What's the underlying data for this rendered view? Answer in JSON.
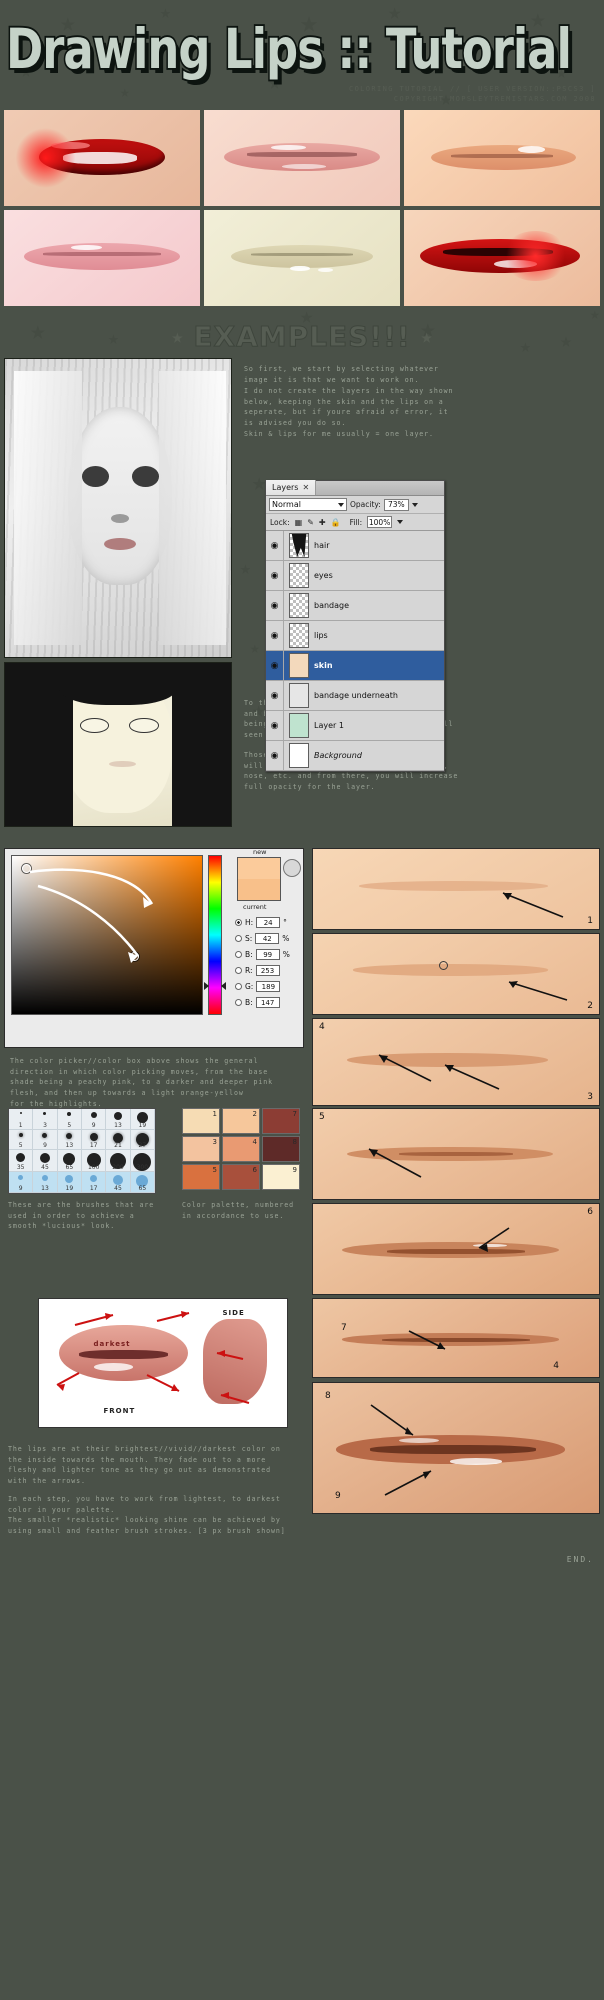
{
  "header": {
    "title": "Drawing Lips :: Tutorial",
    "subtitle_line1": "COLORING TUTORIAL // [ USER VERSION::PSCS3 ]",
    "subtitle_line2": "COPYRIGHT MOPSLEYTREMISTARS.COM 2008"
  },
  "banner": {
    "text": "EXAMPLES!!!",
    "star_left": "★",
    "star_right": "★"
  },
  "examples": {
    "row1": [
      {
        "name": "example-red-lips-open",
        "desc": "red glossy open lips with teeth"
      },
      {
        "name": "example-pink-gloss-lips",
        "desc": "soft pink glossy closed lips"
      },
      {
        "name": "example-peach-lips",
        "desc": "peach toned lips closeup"
      }
    ],
    "row2": [
      {
        "name": "example-pale-pink-lips",
        "desc": "pale pink lips with highlight"
      },
      {
        "name": "example-cream-lips",
        "desc": "cream colored lips"
      },
      {
        "name": "example-bright-red-lips",
        "desc": "bright red parted lips"
      }
    ]
  },
  "section1": {
    "paragraphs": [
      "So first, we start by selecting whatever\nimage it is that we want to work on.",
      "I do not create the layers in the way shown\nbelow, keeping the skin and the lips on a\nseperate, but if youre afraid of error, it\nis advised you do so.\nSkin & lips for me usually = one layer.",
      "To the left, the skin has been filled in,\nand because of the *layer 1* and *skin*\nbeing on a low opacity, the sketch is still\nseen underneath.",
      "Those are the guidelines. With those, you\nwill create the general shape of the lips,\nnose, etc. and from there, you will increase\nfull opacity for the layer."
    ],
    "sketch_top_name": "manga-girl-pencil-sketch",
    "sketch_bottom_name": "manga-girl-flat-color"
  },
  "layers_panel": {
    "tab_label": "Layers",
    "close_glyph": "✕",
    "blend_mode": "Normal",
    "opacity_label": "Opacity:",
    "opacity_value": "73%",
    "lock_label": "Lock:",
    "fill_label": "Fill:",
    "fill_value": "100%",
    "lock_icons": [
      "transparency-lock-icon",
      "brush-lock-icon",
      "move-lock-icon",
      "all-lock-icon"
    ],
    "eye_glyph": "◉",
    "layers": [
      {
        "name": "hair",
        "selected": false,
        "italic": false
      },
      {
        "name": "eyes",
        "selected": false,
        "italic": false
      },
      {
        "name": "bandage",
        "selected": false,
        "italic": false
      },
      {
        "name": "lips",
        "selected": false,
        "italic": false
      },
      {
        "name": "skin",
        "selected": true,
        "italic": false
      },
      {
        "name": "bandage underneath",
        "selected": false,
        "italic": false
      },
      {
        "name": "Layer 1",
        "selected": false,
        "italic": false
      },
      {
        "name": "Background",
        "selected": false,
        "italic": true
      }
    ]
  },
  "color_picker": {
    "new_label": "new",
    "current_label": "current",
    "fields": [
      {
        "id": "H",
        "value": "24",
        "unit": "°",
        "selected": true
      },
      {
        "id": "S",
        "value": "42",
        "unit": "%",
        "selected": false
      },
      {
        "id": "B",
        "value": "99",
        "unit": "%",
        "selected": false
      },
      {
        "id": "R",
        "value": "253",
        "unit": "",
        "selected": false
      },
      {
        "id": "G",
        "value": "189",
        "unit": "",
        "selected": false
      },
      {
        "id": "B",
        "value": "147",
        "unit": "",
        "selected": false
      }
    ],
    "new_color": "#fbcb9b",
    "current_color": "#f8c08a",
    "caption": "The color picker//color box above shows the general\ndirection in which color picking moves, from the base\nshade being a peachy pink, to a darker and deeper pink\nflesh, and then up towards a light orange-yellow\nfor the highlights."
  },
  "brushes": {
    "caption": "These are the brushes that are\nused in order to achieve a\nsmooth *lucious* look.",
    "row1": [
      "1",
      "3",
      "5",
      "9",
      "13",
      "19"
    ],
    "row2": [
      "5",
      "9",
      "13",
      "17",
      "21",
      "27"
    ],
    "row3": [
      "35",
      "45",
      "65",
      "100",
      "200",
      "300"
    ],
    "row4": [
      "9",
      "13",
      "19",
      "17",
      "45",
      "65"
    ]
  },
  "palette": {
    "caption": "Color palette, numbered\nin accordance to use.",
    "swatches": [
      {
        "n": "1",
        "color": "#f6dcb4"
      },
      {
        "n": "2",
        "color": "#f6c79b"
      },
      {
        "n": "7",
        "color": "#8c3d34"
      },
      {
        "n": "3",
        "color": "#f3c39f"
      },
      {
        "n": "4",
        "color": "#e99a72"
      },
      {
        "n": "8",
        "color": "#5e2a28"
      },
      {
        "n": "5",
        "color": "#d9713f"
      },
      {
        "n": "6",
        "color": "#a8503c"
      },
      {
        "n": "9",
        "color": "#fbf0d2"
      }
    ]
  },
  "diagram": {
    "label_side": "SIDE",
    "label_front": "FRONT",
    "label_darkest": "darkest",
    "name": "lips-shading-direction-diagram"
  },
  "bottom_text": {
    "p1": "The lips are at their brightest//vivid//darkest color on\nthe inside towards the mouth. They fade out to a more\nfleshy and lighter tone as they go out as demonstrated\nwith the arrows.",
    "p2": "In each step, you have to work from lightest, to darkest\ncolor in your palette.\nThe smaller *realistic* looking shine can be achieved by\nusing small and feather brush strokes. [3 px brush shown]"
  },
  "steps": {
    "numbers": [
      "1",
      "2",
      "3",
      "4",
      "5",
      "6",
      "7",
      "4",
      "8",
      "9"
    ],
    "end_label": "END."
  },
  "colors": {
    "background": "#4a5148",
    "text": "#9aa396",
    "title_fill": "#c5d2c8",
    "title_stroke": "#0d1410",
    "accent_select": "#2f5d9e"
  }
}
